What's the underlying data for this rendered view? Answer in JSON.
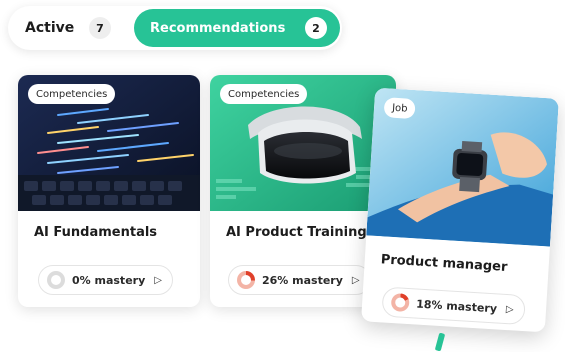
{
  "tabs": {
    "active": {
      "label": "Active",
      "count": "7"
    },
    "recommendations": {
      "label": "Recommendations",
      "count": "2"
    }
  },
  "cards": [
    {
      "tag": "Competencies",
      "title": "AI Fundamentals",
      "mastery_label": "0% mastery",
      "mastery": 0
    },
    {
      "tag": "Competencies",
      "title": "AI Product Training",
      "mastery_label": "26% mastery",
      "mastery": 26
    },
    {
      "tag": "Job",
      "title": "Product manager",
      "mastery_label": "18% mastery",
      "mastery": 18
    }
  ],
  "colors": {
    "accent": "#27c396",
    "progress": "#e0402a"
  },
  "icons": {
    "play": "play-icon"
  }
}
